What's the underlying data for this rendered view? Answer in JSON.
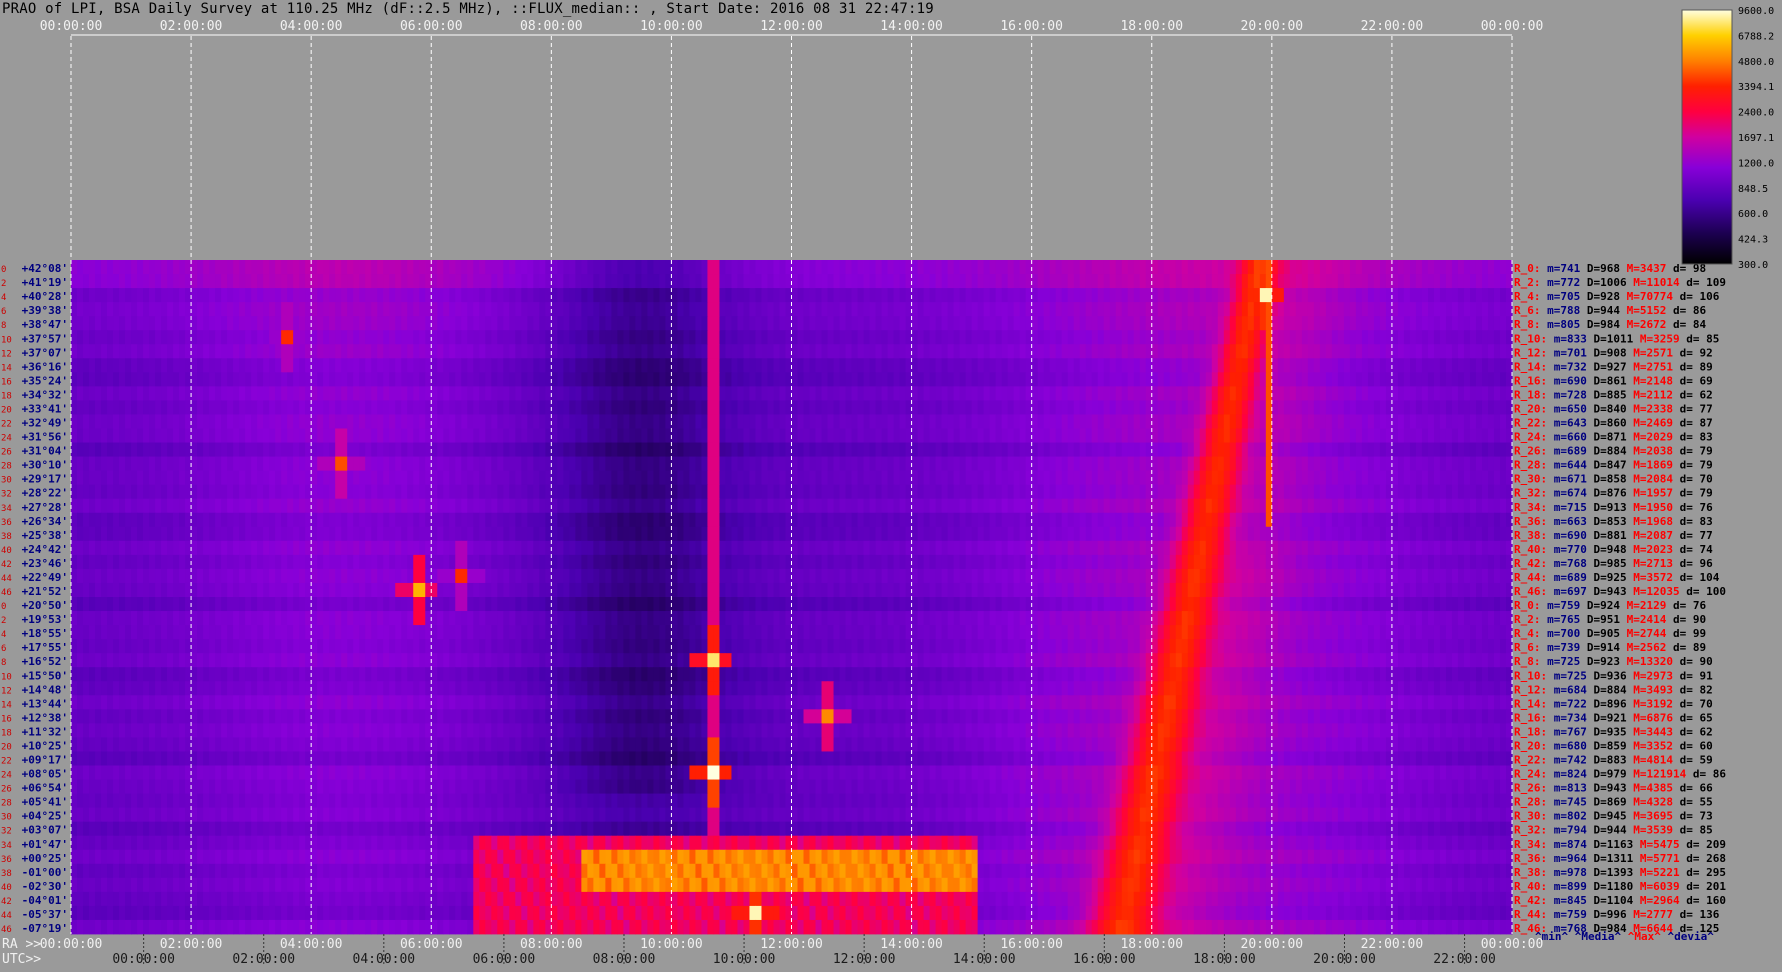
{
  "title": "PRAO of LPI, BSA Daily Survey at 110.25 MHz (dF::2.5 MHz), ::FLUX_median:: , Start Date: 2016 08 31 22:47:19",
  "colors": {
    "background": "#9a9a9a",
    "grid": "#ffffff",
    "decl_label": "#000080",
    "row_index": "#cc0000",
    "stat_min": "#000080",
    "stat_max": "#ff0000"
  },
  "axes": {
    "top_ticks": [
      "00:00:00",
      "02:00:00",
      "04:00:00",
      "06:00:00",
      "08:00:00",
      "10:00:00",
      "12:00:00",
      "14:00:00",
      "16:00:00",
      "18:00:00",
      "20:00:00",
      "22:00:00",
      "00:00:00"
    ],
    "ra_prefix": "RA >>",
    "ra_ticks": [
      "00:00:00",
      "02:00:00",
      "04:00:00",
      "06:00:00",
      "08:00:00",
      "10:00:00",
      "12:00:00",
      "14:00:00",
      "16:00:00",
      "18:00:00",
      "20:00:00",
      "22:00:00",
      "00:00:00"
    ],
    "utc_prefix": "UTC>>",
    "utc_ticks": [
      "00:00:00",
      "02:00:00",
      "04:00:00",
      "06:00:00",
      "08:00:00",
      "10:00:00",
      "12:00:00",
      "14:00:00",
      "16:00:00",
      "18:00:00",
      "20:00:00",
      "22:00:00"
    ]
  },
  "colorbar": {
    "labels": [
      "9600.0",
      "6788.2",
      "4800.0",
      "3394.1",
      "2400.0",
      "1697.1",
      "1200.0",
      "848.5",
      "600.0",
      "424.3",
      "300.0"
    ]
  },
  "row_indices": [
    "0",
    "2",
    "4",
    "6",
    "8",
    "10",
    "12",
    "14",
    "16",
    "18",
    "20",
    "22",
    "24",
    "26",
    "28",
    "30",
    "32",
    "34",
    "36",
    "38",
    "40",
    "42",
    "44",
    "46",
    "0",
    "2",
    "4",
    "6",
    "8",
    "10",
    "12",
    "14",
    "16",
    "18",
    "20",
    "22",
    "24",
    "26",
    "28",
    "30",
    "32",
    "34",
    "36",
    "38",
    "40",
    "42",
    "44",
    "46"
  ],
  "declinations": [
    "+42°08'",
    "+41°19'",
    "+40°28'",
    "+39°38'",
    "+38°47'",
    "+37°57'",
    "+37°07'",
    "+36°16'",
    "+35°24'",
    "+34°32'",
    "+33°41'",
    "+32°49'",
    "+31°56'",
    "+31°04'",
    "+30°10'",
    "+29°17'",
    "+28°22'",
    "+27°28'",
    "+26°34'",
    "+25°38'",
    "+24°42'",
    "+23°46'",
    "+22°49'",
    "+21°52'",
    "+20°50'",
    "+19°53'",
    "+18°55'",
    "+17°55'",
    "+16°52'",
    "+15°50'",
    "+14°48'",
    "+13°44'",
    "+12°38'",
    "+11°32'",
    "+10°25'",
    "+09°17'",
    "+08°05'",
    "+06°54'",
    "+05°41'",
    "+04°25'",
    "+03°07'",
    "+01°47'",
    "+00°25'",
    "-01°00'",
    "-02°30'",
    "-04°01'",
    "-05°37'",
    "-07°19'"
  ],
  "stats": [
    {
      "r": "R_0:",
      "m": "m=741",
      "D": "D=968",
      "M": "M=3437",
      "d": "d= 98"
    },
    {
      "r": "R_2:",
      "m": "m=772",
      "D": "D=1006",
      "M": "M=11014",
      "d": "d= 109"
    },
    {
      "r": "R_4:",
      "m": "m=705",
      "D": "D=928",
      "M": "M=70774",
      "d": "d= 106"
    },
    {
      "r": "R_6:",
      "m": "m=788",
      "D": "D=944",
      "M": "M=5152",
      "d": "d= 86"
    },
    {
      "r": "R_8:",
      "m": "m=805",
      "D": "D=984",
      "M": "M=2672",
      "d": "d= 84"
    },
    {
      "r": "R_10:",
      "m": "m=833",
      "D": "D=1011",
      "M": "M=3259",
      "d": "d= 85"
    },
    {
      "r": "R_12:",
      "m": "m=701",
      "D": "D=908",
      "M": "M=2571",
      "d": "d= 92"
    },
    {
      "r": "R_14:",
      "m": "m=732",
      "D": "D=927",
      "M": "M=2751",
      "d": "d= 89"
    },
    {
      "r": "R_16:",
      "m": "m=690",
      "D": "D=861",
      "M": "M=2148",
      "d": "d= 69"
    },
    {
      "r": "R_18:",
      "m": "m=728",
      "D": "D=885",
      "M": "M=2112",
      "d": "d= 62"
    },
    {
      "r": "R_20:",
      "m": "m=650",
      "D": "D=840",
      "M": "M=2338",
      "d": "d= 77"
    },
    {
      "r": "R_22:",
      "m": "m=643",
      "D": "D=860",
      "M": "M=2469",
      "d": "d= 87"
    },
    {
      "r": "R_24:",
      "m": "m=660",
      "D": "D=871",
      "M": "M=2029",
      "d": "d= 83"
    },
    {
      "r": "R_26:",
      "m": "m=689",
      "D": "D=884",
      "M": "M=2038",
      "d": "d= 79"
    },
    {
      "r": "R_28:",
      "m": "m=644",
      "D": "D=847",
      "M": "M=1869",
      "d": "d= 79"
    },
    {
      "r": "R_30:",
      "m": "m=671",
      "D": "D=858",
      "M": "M=2084",
      "d": "d= 70"
    },
    {
      "r": "R_32:",
      "m": "m=674",
      "D": "D=876",
      "M": "M=1957",
      "d": "d= 79"
    },
    {
      "r": "R_34:",
      "m": "m=715",
      "D": "D=913",
      "M": "M=1950",
      "d": "d= 76"
    },
    {
      "r": "R_36:",
      "m": "m=663",
      "D": "D=853",
      "M": "M=1968",
      "d": "d= 83"
    },
    {
      "r": "R_38:",
      "m": "m=690",
      "D": "D=881",
      "M": "M=2087",
      "d": "d= 77"
    },
    {
      "r": "R_40:",
      "m": "m=770",
      "D": "D=948",
      "M": "M=2023",
      "d": "d= 74"
    },
    {
      "r": "R_42:",
      "m": "m=768",
      "D": "D=985",
      "M": "M=2713",
      "d": "d= 96"
    },
    {
      "r": "R_44:",
      "m": "m=689",
      "D": "D=925",
      "M": "M=3572",
      "d": "d= 104"
    },
    {
      "r": "R_46:",
      "m": "m=697",
      "D": "D=943",
      "M": "M=12035",
      "d": "d= 100"
    },
    {
      "r": "R_0:",
      "m": "m=759",
      "D": "D=924",
      "M": "M=2129",
      "d": "d= 76"
    },
    {
      "r": "R_2:",
      "m": "m=765",
      "D": "D=951",
      "M": "M=2414",
      "d": "d= 90"
    },
    {
      "r": "R_4:",
      "m": "m=700",
      "D": "D=905",
      "M": "M=2744",
      "d": "d= 99"
    },
    {
      "r": "R_6:",
      "m": "m=739",
      "D": "D=914",
      "M": "M=2562",
      "d": "d= 89"
    },
    {
      "r": "R_8:",
      "m": "m=725",
      "D": "D=923",
      "M": "M=13320",
      "d": "d= 90"
    },
    {
      "r": "R_10:",
      "m": "m=725",
      "D": "D=936",
      "M": "M=2973",
      "d": "d= 91"
    },
    {
      "r": "R_12:",
      "m": "m=684",
      "D": "D=884",
      "M": "M=3493",
      "d": "d= 82"
    },
    {
      "r": "R_14:",
      "m": "m=722",
      "D": "D=896",
      "M": "M=3192",
      "d": "d= 70"
    },
    {
      "r": "R_16:",
      "m": "m=734",
      "D": "D=921",
      "M": "M=6876",
      "d": "d= 65"
    },
    {
      "r": "R_18:",
      "m": "m=767",
      "D": "D=935",
      "M": "M=3443",
      "d": "d= 62"
    },
    {
      "r": "R_20:",
      "m": "m=680",
      "D": "D=859",
      "M": "M=3352",
      "d": "d= 60"
    },
    {
      "r": "R_22:",
      "m": "m=742",
      "D": "D=883",
      "M": "M=4814",
      "d": "d= 59"
    },
    {
      "r": "R_24:",
      "m": "m=824",
      "D": "D=979",
      "M": "M=121914",
      "d": "d= 86"
    },
    {
      "r": "R_26:",
      "m": "m=813",
      "D": "D=943",
      "M": "M=4385",
      "d": "d= 66"
    },
    {
      "r": "R_28:",
      "m": "m=745",
      "D": "D=869",
      "M": "M=4328",
      "d": "d= 55"
    },
    {
      "r": "R_30:",
      "m": "m=802",
      "D": "D=945",
      "M": "M=3695",
      "d": "d= 73"
    },
    {
      "r": "R_32:",
      "m": "m=794",
      "D": "D=944",
      "M": "M=3539",
      "d": "d= 85"
    },
    {
      "r": "R_34:",
      "m": "m=874",
      "D": "D=1163",
      "M": "M=5475",
      "d": "d= 209"
    },
    {
      "r": "R_36:",
      "m": "m=964",
      "D": "D=1311",
      "M": "M=5771",
      "d": "d= 268"
    },
    {
      "r": "R_38:",
      "m": "m=978",
      "D": "D=1393",
      "M": "M=5221",
      "d": "d= 295"
    },
    {
      "r": "R_40:",
      "m": "m=899",
      "D": "D=1180",
      "M": "M=6039",
      "d": "d= 201"
    },
    {
      "r": "R_42:",
      "m": "m=845",
      "D": "D=1104",
      "M": "M=2964",
      "d": "d= 160"
    },
    {
      "r": "R_44:",
      "m": "m=759",
      "D": "D=996",
      "M": "M=2777",
      "d": "d= 136"
    },
    {
      "r": "R_46:",
      "m": "m=768",
      "D": "D=984",
      "M": "M=6644",
      "d": "d= 125"
    }
  ],
  "legend": {
    "min": "^min^",
    "median": "^Media^",
    "max": "^Max^",
    "deviation": "^devia^"
  },
  "chart_data": {
    "type": "heatmap",
    "x_unit": "time (hours)",
    "color_scale": [
      300.0,
      424.3,
      600.0,
      848.5,
      1200.0,
      1697.1,
      2400.0,
      3394.1,
      4800.0,
      6788.2,
      9600.0
    ],
    "row_count": 48,
    "features": [
      {
        "kind": "diagonal_band",
        "from_hour": 19.8,
        "to_hour": 17.5,
        "from_row": 0,
        "to_row": 47,
        "peak": 3000
      },
      {
        "kind": "rect_block",
        "hour_start": 6.7,
        "hour_end": 15.1,
        "row_start": 41,
        "row_end": 47,
        "peak": 2400
      },
      {
        "kind": "rect_block",
        "hour_start": 8.5,
        "hour_end": 15.1,
        "row_start": 42,
        "row_end": 44,
        "peak": 5500
      },
      {
        "kind": "vertical_line",
        "hour": 10.7,
        "peak": 1900
      },
      {
        "kind": "vertical_line",
        "hour": 19.95,
        "row_start": 0,
        "row_end": 18,
        "peak": 4000
      },
      {
        "kind": "point",
        "hour": 10.7,
        "row": 36,
        "peak": 9600
      },
      {
        "kind": "point",
        "hour": 10.7,
        "row": 28,
        "peak": 8000
      },
      {
        "kind": "point",
        "hour": 19.9,
        "row": 2,
        "peak": 9000
      },
      {
        "kind": "point",
        "hour": 5.8,
        "row": 23,
        "peak": 6000
      },
      {
        "kind": "point",
        "hour": 6.5,
        "row": 22,
        "peak": 3500
      },
      {
        "kind": "point",
        "hour": 12.6,
        "row": 32,
        "peak": 5000
      },
      {
        "kind": "point",
        "hour": 11.4,
        "row": 46,
        "peak": 9000
      },
      {
        "kind": "point",
        "hour": 4.5,
        "row": 14,
        "peak": 4000
      },
      {
        "kind": "point",
        "hour": 3.6,
        "row": 5,
        "peak": 3500
      }
    ]
  }
}
